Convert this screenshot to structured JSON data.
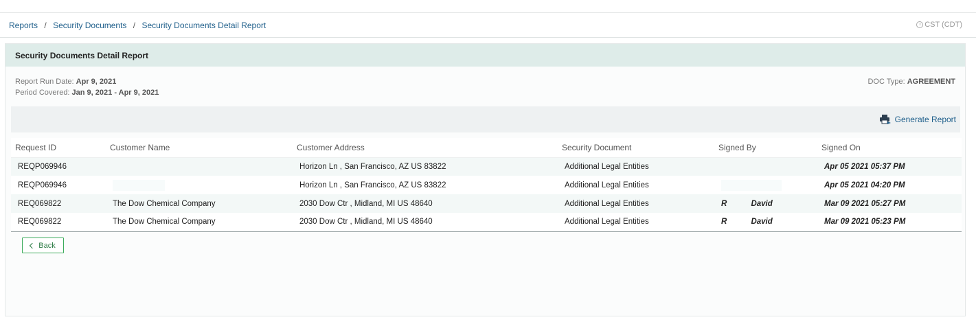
{
  "breadcrumb": {
    "items": [
      "Reports",
      "Security Documents",
      "Security Documents Detail Report"
    ],
    "separator": "/"
  },
  "timezone": "CST (CDT)",
  "panel": {
    "title": "Security Documents Detail Report",
    "run_date_label": "Report Run Date: ",
    "run_date_value": "Apr 9, 2021",
    "period_label": "Period Covered: ",
    "period_value": "Jan 9, 2021 - Apr 9, 2021",
    "doc_type_label": "DOC Type: ",
    "doc_type_value": "AGREEMENT"
  },
  "toolbar": {
    "generate_label": "Generate Report",
    "generate_icon": "print-icon"
  },
  "table": {
    "columns": [
      "Request ID",
      "Customer Name",
      "Customer Address",
      "Security Document",
      "Signed By",
      "Signed On"
    ],
    "rows": [
      {
        "request_id": "REQP069946",
        "customer_name": "",
        "address": "Horizon Ln , San Francisco,  AZ  US 83822",
        "document": "Additional Legal Entities",
        "signed_by": "",
        "signed_on": "Apr 05 2021 05:37 PM"
      },
      {
        "request_id": "REQP069946",
        "customer_name": "",
        "address": "Horizon Ln , San Francisco,  AZ  US 83822",
        "document": "Additional Legal Entities",
        "signed_by": "",
        "signed_on": "Apr 05 2021 04:20 PM"
      },
      {
        "request_id": "REQ069822",
        "customer_name": "The Dow Chemical Company",
        "address": "2030 Dow Ctr , Midland,  MI  US 48640",
        "document": "Additional Legal Entities",
        "signed_by": "R           David",
        "signed_on": "Mar 09 2021 05:27 PM"
      },
      {
        "request_id": "REQ069822",
        "customer_name": "The Dow Chemical Company",
        "address": "2030 Dow Ctr , Midland,  MI  US 48640",
        "document": "Additional Legal Entities",
        "signed_by": "R           David",
        "signed_on": "Mar 09 2021 05:23 PM"
      }
    ]
  },
  "back_label": "Back",
  "colors": {
    "accent_green": "#3cab5c",
    "link_blue": "#1f5f8b",
    "header_bg": "#deece9"
  }
}
